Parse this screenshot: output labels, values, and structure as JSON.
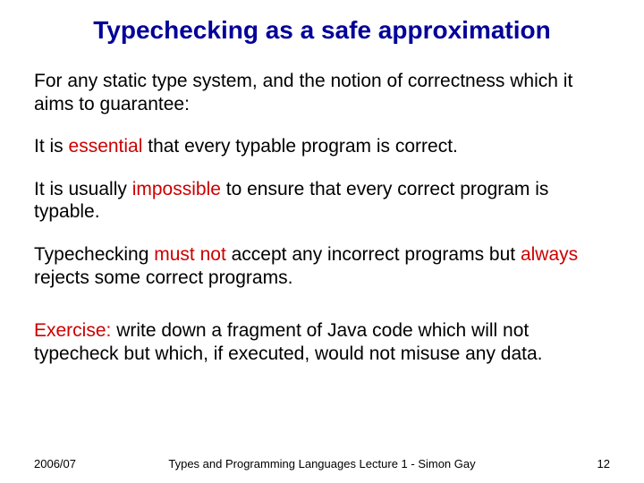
{
  "title": "Typechecking as a safe approximation",
  "p1a": "For any static type system, and the notion of correctness which it aims to guarantee:",
  "p2": {
    "a": "It is ",
    "b": "essential",
    "c": " that every typable program is correct."
  },
  "p3": {
    "a": "It is usually ",
    "b": "impossible",
    "c": " to ensure that every correct program is typable."
  },
  "p4": {
    "a": "Typechecking ",
    "b": "must not",
    "c": " accept any incorrect programs but ",
    "d": "always",
    "e": " rejects some correct programs."
  },
  "p5": {
    "a": "Exercise:",
    "b": " write down a fragment of Java code which will not typecheck but which, if executed, would not misuse any data."
  },
  "footer": {
    "left": "2006/07",
    "center": "Types and Programming Languages Lecture 1 - Simon Gay",
    "right": "12"
  }
}
